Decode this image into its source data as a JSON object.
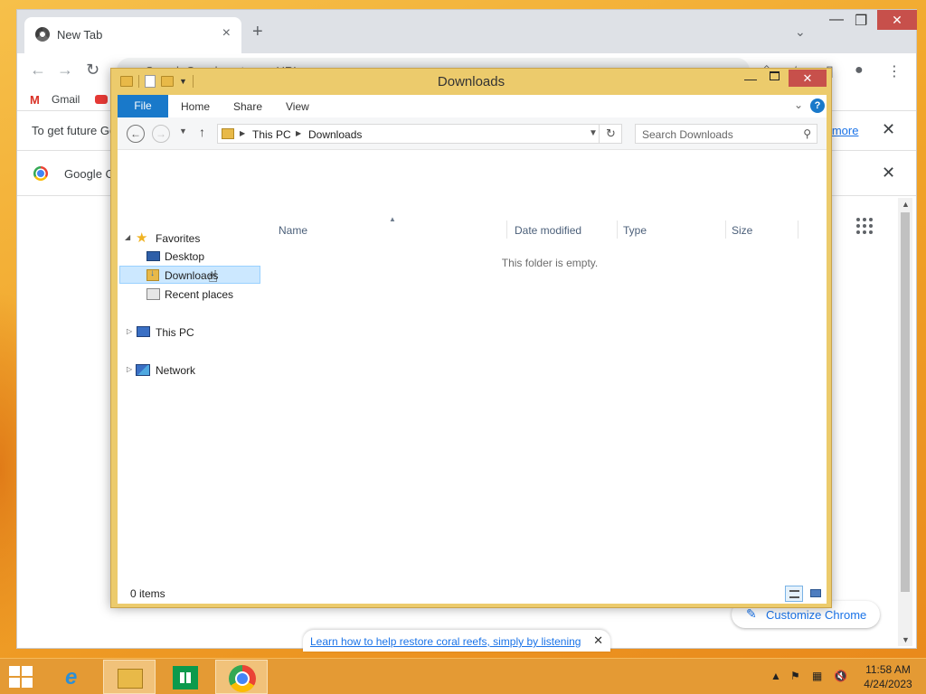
{
  "chrome": {
    "tab_title": "New Tab",
    "new_tab": "+",
    "omnibox_placeholder": "Search Google or type a URL",
    "bookmarks": {
      "gmail": "Gmail"
    },
    "infobar_text": "To get future Go",
    "infobar_link": "n more",
    "default_text": "Google C",
    "customize_label": "Customize Chrome",
    "coral_text": "Learn how to help restore coral reefs, simply by listening"
  },
  "explorer": {
    "title": "Downloads",
    "ribbon_tabs": {
      "file": "File",
      "home": "Home",
      "share": "Share",
      "view": "View"
    },
    "address": {
      "root": "This PC",
      "current": "Downloads"
    },
    "search_placeholder": "Search Downloads",
    "nav": {
      "favorites": "Favorites",
      "desktop": "Desktop",
      "downloads": "Downloads",
      "recent": "Recent places",
      "this_pc": "This PC",
      "network": "Network"
    },
    "columns": {
      "name": "Name",
      "date": "Date modified",
      "type": "Type",
      "size": "Size"
    },
    "empty_message": "This folder is empty.",
    "status_count": "0 items"
  },
  "taskbar": {
    "time": "11:58 AM",
    "date": "4/24/2023"
  },
  "colors": {
    "explorer_frame": "#eccb6c",
    "ribbon_file": "#1979ca",
    "close_red": "#c7504b",
    "taskbar": "#e49a34",
    "selection": "#cce8ff"
  }
}
